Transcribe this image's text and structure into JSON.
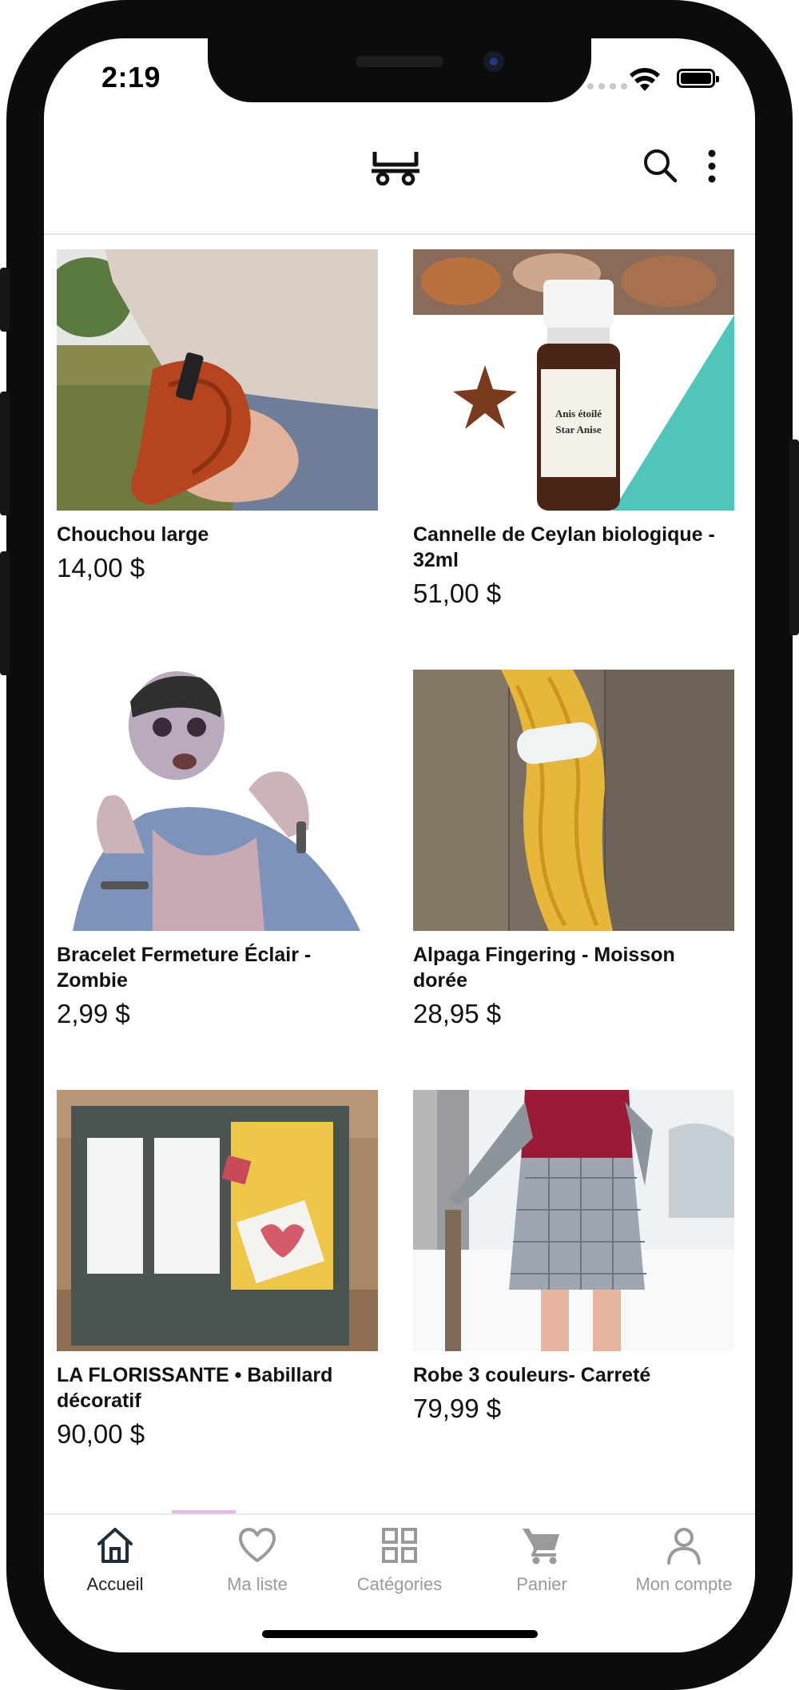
{
  "status_bar": {
    "time": "2:19"
  },
  "app_bar": {
    "logo_icon": "shop-logo-icon",
    "actions": [
      "search-icon",
      "more-vertical-icon"
    ]
  },
  "products": [
    {
      "name": "Chouchou large",
      "price": "14,00 $"
    },
    {
      "name": "Cannelle de Ceylan biologique - 32ml",
      "price": "51,00 $"
    },
    {
      "name": "Bracelet Fermeture Éclair - Zombie",
      "price": "2,99 $"
    },
    {
      "name": "Alpaga Fingering - Moisson dorée",
      "price": "28,95 $"
    },
    {
      "name": "LA FLORISSANTE • Babillard décoratif",
      "price": "90,00 $"
    },
    {
      "name": "Robe 3 couleurs- Carreté",
      "price": "79,99 $"
    }
  ],
  "bottom_nav": [
    {
      "label": "Accueil",
      "icon": "home-icon",
      "active": true
    },
    {
      "label": "Ma liste",
      "icon": "heart-icon",
      "active": false
    },
    {
      "label": "Catégories",
      "icon": "grid-icon",
      "active": false
    },
    {
      "label": "Panier",
      "icon": "cart-icon",
      "active": false
    },
    {
      "label": "Mon compte",
      "icon": "user-icon",
      "active": false
    }
  ],
  "colors": {
    "active": "#1f2d3d",
    "inactive": "#9a9a9a",
    "divider": "#e3e3e3"
  }
}
